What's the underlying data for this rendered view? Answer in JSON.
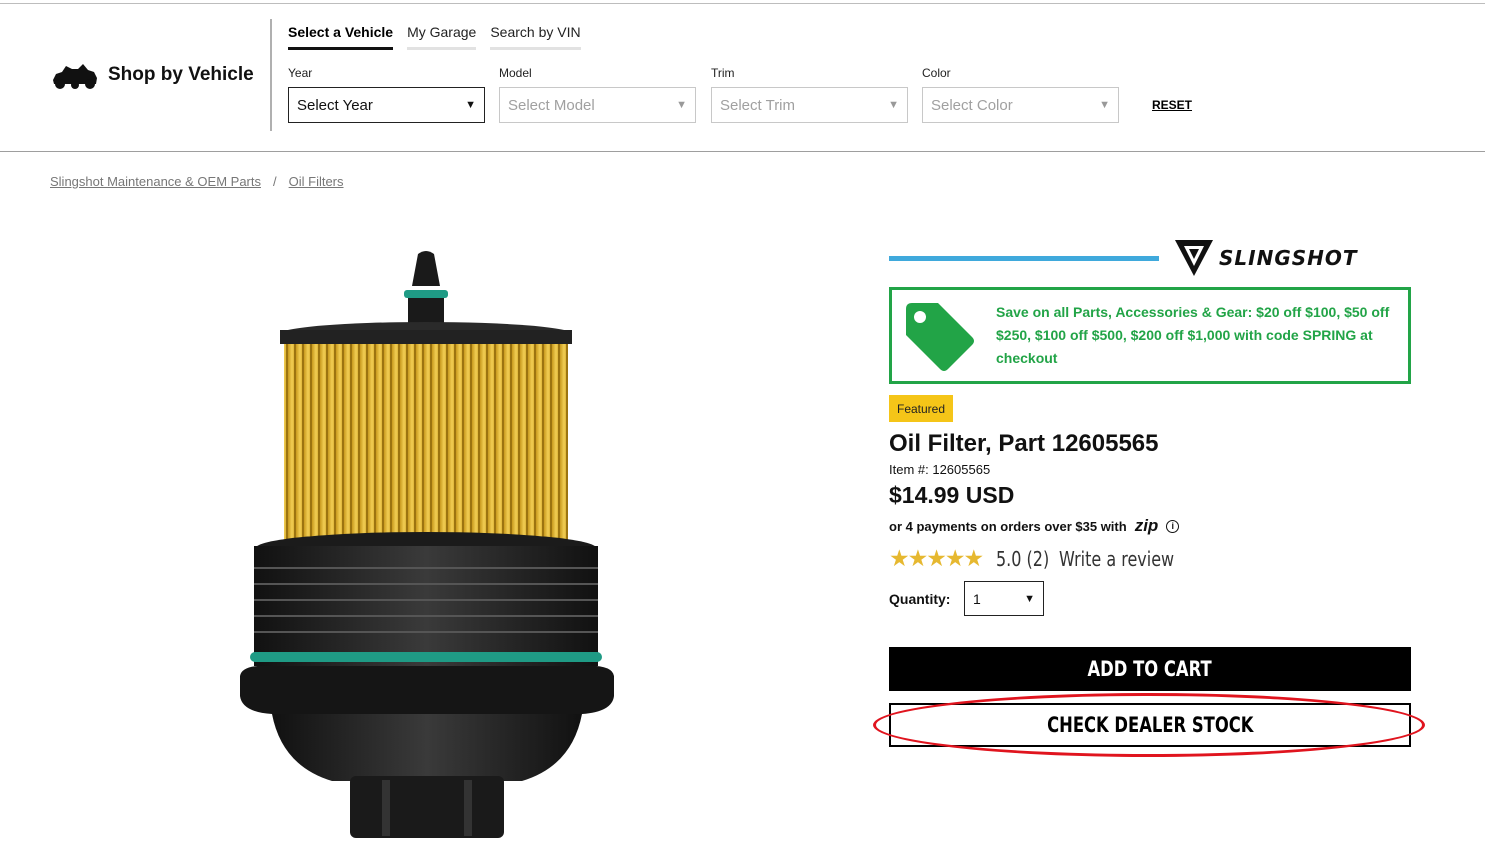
{
  "vehicle_bar": {
    "shop_by_vehicle": "Shop by Vehicle",
    "tabs": [
      {
        "label": "Select a Vehicle",
        "active": true
      },
      {
        "label": "My Garage",
        "active": false
      },
      {
        "label": "Search by VIN",
        "active": false
      }
    ],
    "fields": {
      "year": {
        "label": "Year",
        "value": "Select Year"
      },
      "model": {
        "label": "Model",
        "value": "Select Model"
      },
      "trim": {
        "label": "Trim",
        "value": "Select Trim"
      },
      "color": {
        "label": "Color",
        "value": "Select Color"
      }
    },
    "reset_label": "RESET"
  },
  "breadcrumb": {
    "items": [
      "Slingshot Maintenance & OEM Parts",
      "Oil Filters"
    ],
    "separator": "/"
  },
  "brand": {
    "name": "SLINGSHOT",
    "accent_color": "#3fa9dc"
  },
  "promo": {
    "text": "Save on all Parts, Accessories & Gear: $20 off $100, $50 off $250, $100 off $500, $200 off $1,000 with code SPRING at checkout",
    "color": "#22a447",
    "icon": "price-tag-icon"
  },
  "product": {
    "badge": "Featured",
    "title": "Oil Filter, Part 12605565",
    "item_number": "Item #: 12605565",
    "price": "$14.99 USD",
    "installments_text": "or 4 payments on orders over $35 with",
    "installments_provider": "zip",
    "rating": 5.0,
    "rating_text": "5.0 (2)",
    "write_review": "Write a review",
    "quantity_label": "Quantity:",
    "quantity_value": "1",
    "add_to_cart": "ADD TO CART",
    "check_dealer_stock": "CHECK DEALER STOCK"
  },
  "annotation": {
    "highlight_color": "#e0141e",
    "highlighted": "check_dealer_stock"
  }
}
